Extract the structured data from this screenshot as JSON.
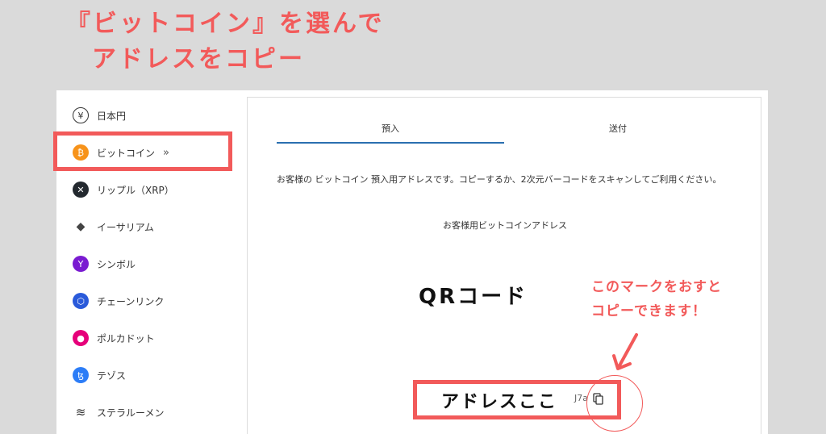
{
  "annotation": {
    "heading_line1": "『ビットコイン』を選んで",
    "heading_line2": "アドレスをコピー",
    "note_line1": "このマークをおすと",
    "note_line2": "コピーできます！",
    "qr_label": "QRコード",
    "address_label": "アドレスここ",
    "accent_color": "#f25a5a"
  },
  "sidebar": {
    "items": [
      {
        "label": "日本円",
        "icon": "yen-icon",
        "glyph": "¥"
      },
      {
        "label": "ビットコイン",
        "icon": "bitcoin-icon",
        "glyph": "₿",
        "selected": true,
        "chevron": "»"
      },
      {
        "label": "リップル（XRP）",
        "icon": "xrp-icon",
        "glyph": "✕"
      },
      {
        "label": "イーサリアム",
        "icon": "ethereum-icon",
        "glyph": "◆"
      },
      {
        "label": "シンボル",
        "icon": "symbol-icon",
        "glyph": "Y"
      },
      {
        "label": "チェーンリンク",
        "icon": "chainlink-icon",
        "glyph": "⬡"
      },
      {
        "label": "ポルカドット",
        "icon": "polkadot-icon",
        "glyph": "●"
      },
      {
        "label": "テゾス",
        "icon": "tezos-icon",
        "glyph": "ꜩ"
      },
      {
        "label": "ステラルーメン",
        "icon": "stellar-icon",
        "glyph": "≋"
      }
    ]
  },
  "main": {
    "tabs": [
      {
        "label": "預入",
        "active": true
      },
      {
        "label": "送付",
        "active": false
      }
    ],
    "notice": "お客様の ビットコイン 預入用アドレスです。コピーするか、2次元バーコードをスキャンしてご利用ください。",
    "address_title": "お客様用ビットコインアドレス",
    "address_tail": "J7a"
  }
}
